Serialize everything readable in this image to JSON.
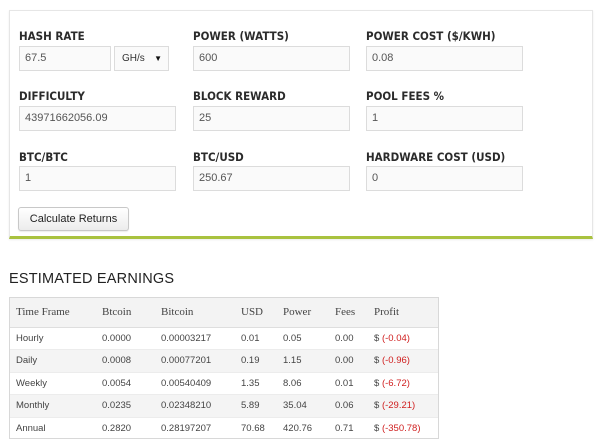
{
  "form": {
    "hash_rate": {
      "label": "HASH RATE",
      "value": "67.5",
      "unit": "GH/s"
    },
    "power": {
      "label": "POWER (WATTS)",
      "value": "600"
    },
    "power_cost": {
      "label": "POWER COST ($/KWH)",
      "value": "0.08"
    },
    "difficulty": {
      "label": "DIFFICULTY",
      "value": "43971662056.09"
    },
    "block_reward": {
      "label": "BLOCK REWARD",
      "value": "25"
    },
    "pool_fees": {
      "label": "POOL FEES %",
      "value": "1"
    },
    "btc_btc": {
      "label": "BTC/BTC",
      "value": "1"
    },
    "btc_usd": {
      "label": "BTC/USD",
      "value": "250.67"
    },
    "hardware_cost": {
      "label": "HARDWARE COST (USD)",
      "value": "0"
    },
    "calculate_label": "Calculate Returns",
    "caret_icon": "▼"
  },
  "earnings": {
    "title": "ESTIMATED EARNINGS",
    "columns": [
      "Time Frame",
      "Btcoin",
      "Bitcoin",
      "USD",
      "Power",
      "Fees",
      "Profit"
    ],
    "rows": [
      {
        "frame": "Hourly",
        "btcoin": "0.0000",
        "bitcoin": "0.00003217",
        "usd": "0.01",
        "power": "0.05",
        "fees": "0.00",
        "profit_prefix": "$",
        "profit": "(-0.04)"
      },
      {
        "frame": "Daily",
        "btcoin": "0.0008",
        "bitcoin": "0.00077201",
        "usd": "0.19",
        "power": "1.15",
        "fees": "0.00",
        "profit_prefix": "$",
        "profit": "(-0.96)"
      },
      {
        "frame": "Weekly",
        "btcoin": "0.0054",
        "bitcoin": "0.00540409",
        "usd": "1.35",
        "power": "8.06",
        "fees": "0.01",
        "profit_prefix": "$",
        "profit": "(-6.72)"
      },
      {
        "frame": "Monthly",
        "btcoin": "0.0235",
        "bitcoin": "0.02348210",
        "usd": "5.89",
        "power": "35.04",
        "fees": "0.06",
        "profit_prefix": "$",
        "profit": "(-29.21)"
      },
      {
        "frame": "Annual",
        "btcoin": "0.2820",
        "bitcoin": "0.28197207",
        "usd": "70.68",
        "power": "420.76",
        "fees": "0.71",
        "profit_prefix": "$",
        "profit": "(-350.78)"
      }
    ],
    "negative_color": "#d02020"
  },
  "accent_color": "#a9c23f"
}
